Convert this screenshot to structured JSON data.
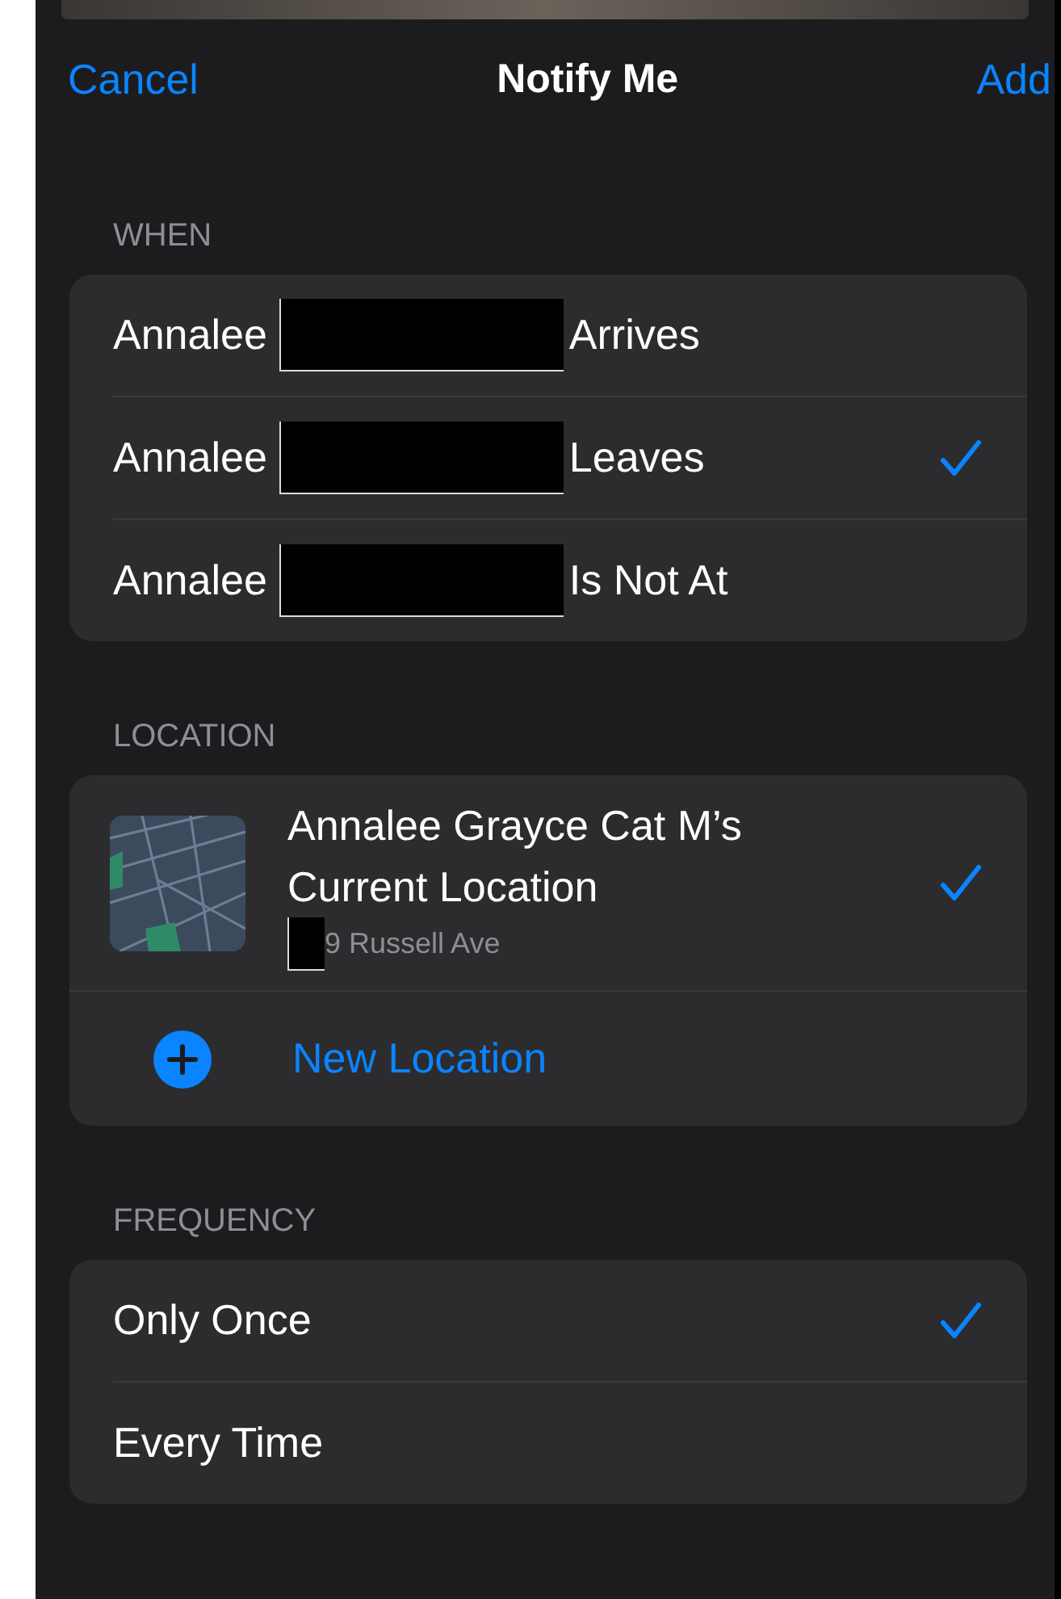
{
  "nav": {
    "cancel": "Cancel",
    "title": "Notify Me",
    "add": "Add"
  },
  "when": {
    "header": "WHEN",
    "options": [
      {
        "name": "Annalee",
        "event": "Arrives",
        "selected": false
      },
      {
        "name": "Annalee",
        "event": "Leaves",
        "selected": true
      },
      {
        "name": "Annalee",
        "event": "Is Not At",
        "selected": false
      }
    ]
  },
  "location": {
    "header": "LOCATION",
    "items": [
      {
        "kind": "place",
        "title": "Annalee Grayce Cat M’s Current Location",
        "address": "9 Russell Ave",
        "selected": true
      },
      {
        "kind": "add",
        "title": "New Location"
      }
    ]
  },
  "frequency": {
    "header": "FREQUENCY",
    "options": [
      {
        "label": "Only Once",
        "selected": true
      },
      {
        "label": "Every Time",
        "selected": false
      }
    ]
  }
}
